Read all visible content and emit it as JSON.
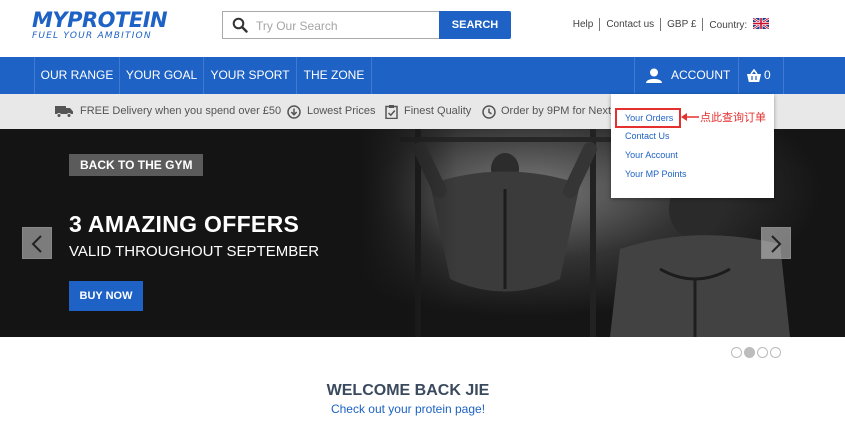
{
  "header": {
    "logo": "MYPROTEIN",
    "tagline": "FUEL YOUR AMBITION",
    "search_placeholder": "Try Our Search",
    "search_button": "SEARCH",
    "links": {
      "help": "Help",
      "contact": "Contact us",
      "currency": "GBP £",
      "country": "Country:"
    }
  },
  "nav": {
    "items": [
      "OUR RANGE",
      "YOUR GOAL",
      "YOUR SPORT",
      "THE ZONE"
    ],
    "account": "ACCOUNT",
    "basket_count": "0"
  },
  "usp": {
    "delivery": "FREE Delivery when you spend over £50",
    "prices": "Lowest Prices",
    "quality": "Finest Quality",
    "order": "Order by 9PM for Next"
  },
  "hero": {
    "tag": "BACK TO THE GYM",
    "title": "3 AMAZING OFFERS",
    "subtitle": "VALID THROUGHOUT SEPTEMBER",
    "button": "BUY NOW",
    "carousel_slides": 4,
    "carousel_active": 2
  },
  "welcome": {
    "title": "WELCOME BACK JIE",
    "subtitle": "Check out your protein page!"
  },
  "account_menu": {
    "items": [
      "Your Orders",
      "Contact Us",
      "Your Account",
      "Your MP Points"
    ]
  },
  "annotation": {
    "text": "点此查询订单",
    "color": "#e53030"
  },
  "colors": {
    "brand_blue": "#1d62c4",
    "usp_bar": "#e8e8e8",
    "hero_bg": "#141414"
  }
}
